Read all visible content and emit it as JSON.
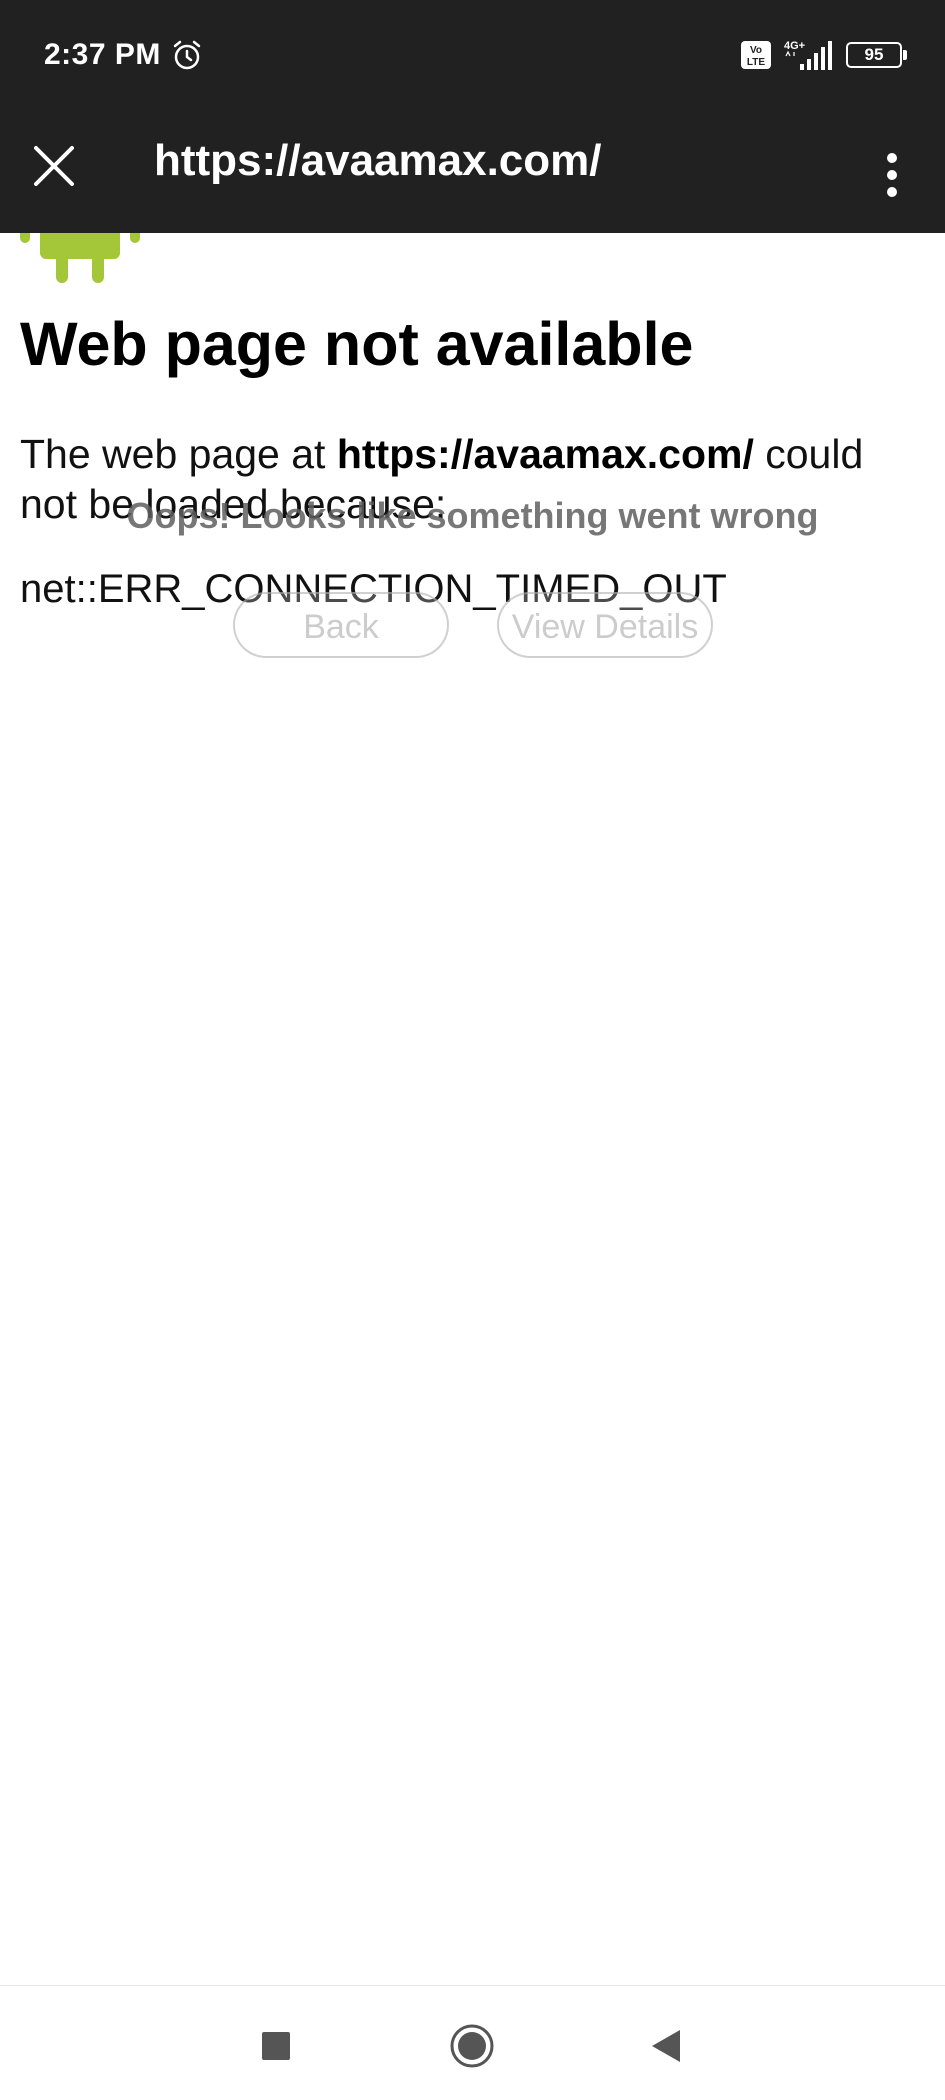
{
  "status_bar": {
    "time": "2:37 PM",
    "alarm_icon": "alarm-clock-icon",
    "volte_label": "Vo LTE",
    "network_label": "4G+",
    "battery_level": "95"
  },
  "app_bar": {
    "close_icon": "close-icon",
    "url": "https://avaamax.com/",
    "menu_icon": "overflow-menu-icon"
  },
  "error_page": {
    "heading": "Web page not available",
    "desc_prefix": "The web page at ",
    "desc_url": "https://avaamax.com/",
    "desc_suffix": " could not be loaded because:",
    "error_code": "net::ERR_CONNECTION_TIMED_OUT"
  },
  "overlay": {
    "message": "Oops! Looks like something went wrong",
    "back_label": "Back",
    "details_label": "View Details"
  },
  "nav_bar": {
    "recents_icon": "recents-square-icon",
    "home_icon": "home-circle-icon",
    "back_icon": "back-triangle-icon"
  },
  "colors": {
    "bar_background": "#212121",
    "android_green": "#A4C639",
    "overlay_text": "#5f5f5f"
  }
}
